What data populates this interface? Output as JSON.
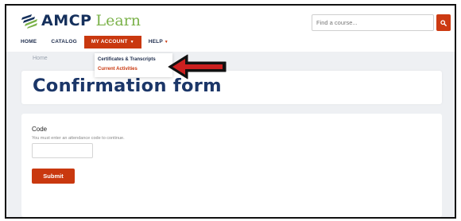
{
  "logo": {
    "brand": "AMCP",
    "product": "Learn"
  },
  "search": {
    "placeholder": "Find a course..."
  },
  "nav": {
    "home": "HOME",
    "catalog": "CATALOG",
    "my_account": "MY ACCOUNT",
    "help": "HELP"
  },
  "dropdown": {
    "items": [
      "Certificates & Transcripts",
      "Current Activities"
    ]
  },
  "breadcrumb": "Home",
  "page": {
    "title": "Confirmation form"
  },
  "form": {
    "code_label": "Code",
    "code_help": "You must enter an attendance code to continue.",
    "submit_label": "Submit"
  },
  "colors": {
    "accent": "#c9380f",
    "brand_navy": "#15305c",
    "brand_green": "#7bb24a"
  },
  "icons": {
    "search": "search-icon",
    "logo": "amcp-logo-icon",
    "caret": "chevron-down-icon",
    "annotation": "arrow-left-icon"
  }
}
